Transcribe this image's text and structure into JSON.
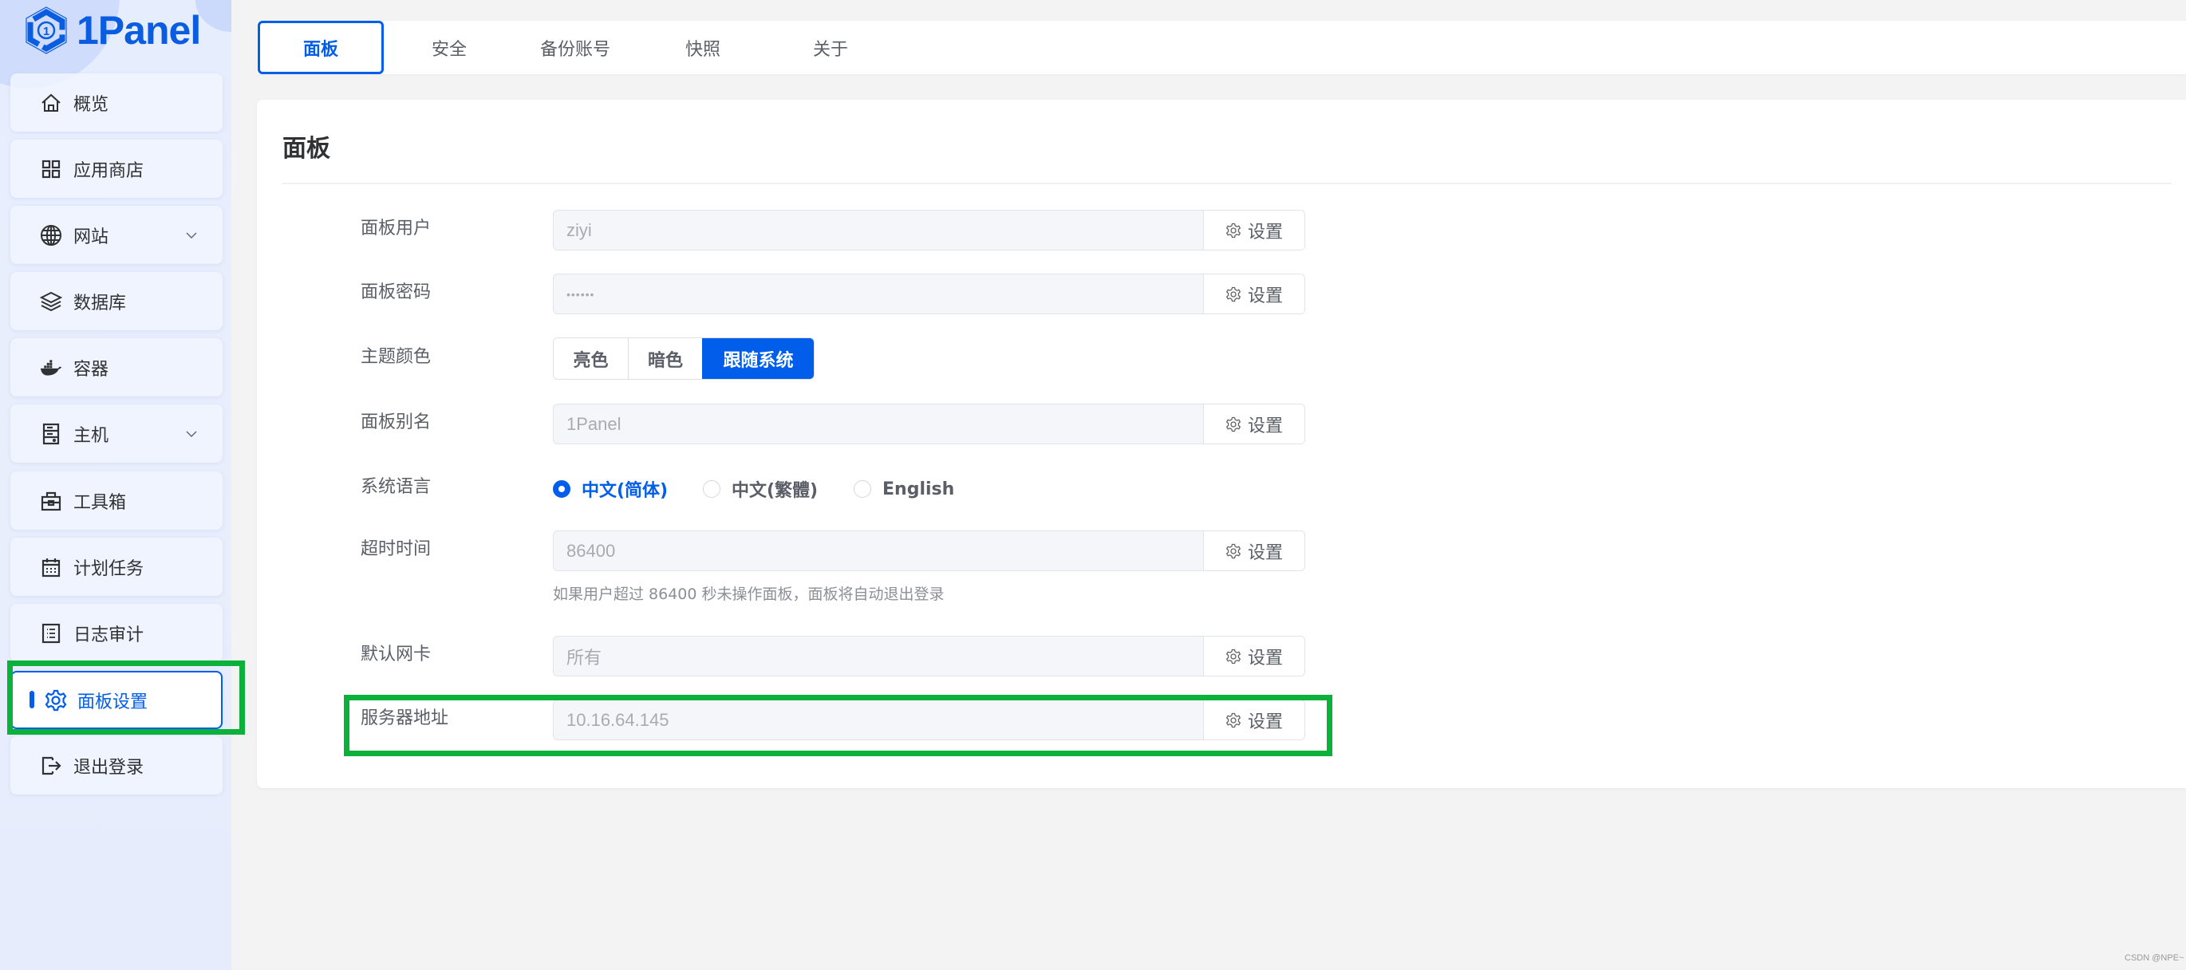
{
  "app": {
    "name": "1Panel"
  },
  "sidebar": {
    "items": [
      {
        "label": "概览",
        "icon": "home-icon",
        "has_chevron": false
      },
      {
        "label": "应用商店",
        "icon": "apps-grid-icon",
        "has_chevron": false
      },
      {
        "label": "网站",
        "icon": "globe-icon",
        "has_chevron": true
      },
      {
        "label": "数据库",
        "icon": "layers-icon",
        "has_chevron": false
      },
      {
        "label": "容器",
        "icon": "docker-icon",
        "has_chevron": false
      },
      {
        "label": "主机",
        "icon": "server-icon",
        "has_chevron": true
      },
      {
        "label": "工具箱",
        "icon": "toolbox-icon",
        "has_chevron": false
      },
      {
        "label": "计划任务",
        "icon": "calendar-icon",
        "has_chevron": false
      },
      {
        "label": "日志审计",
        "icon": "log-list-icon",
        "has_chevron": false
      },
      {
        "label": "面板设置",
        "icon": "gear-icon",
        "has_chevron": false,
        "active": true
      },
      {
        "label": "退出登录",
        "icon": "logout-icon",
        "has_chevron": false
      }
    ]
  },
  "tabs": [
    {
      "label": "面板",
      "active": true
    },
    {
      "label": "安全"
    },
    {
      "label": "备份账号"
    },
    {
      "label": "快照"
    },
    {
      "label": "关于"
    }
  ],
  "card": {
    "title": "面板",
    "set_button_label": "设置",
    "fields": {
      "user": {
        "label": "面板用户",
        "value": "ziyi"
      },
      "password": {
        "label": "面板密码",
        "value": "••••••"
      },
      "theme": {
        "label": "主题颜色",
        "options": [
          "亮色",
          "暗色",
          "跟随系统"
        ],
        "selected": "跟随系统"
      },
      "alias": {
        "label": "面板别名",
        "value": "1Panel"
      },
      "language": {
        "label": "系统语言",
        "options": [
          "中文(简体)",
          "中文(繁體)",
          "English"
        ],
        "selected": "中文(简体)"
      },
      "timeout": {
        "label": "超时时间",
        "value": "86400",
        "hint": "如果用户超过 86400 秒未操作面板，面板将自动退出登录"
      },
      "nic": {
        "label": "默认网卡",
        "value": "所有"
      },
      "server_address": {
        "label": "服务器地址",
        "value": "10.16.64.145"
      }
    }
  },
  "annotations": {
    "highlight_color": "#0cb13c"
  },
  "colors": {
    "accent": "#005eeb",
    "logo": "#0a5ce0"
  },
  "watermark": "CSDN @NPE~"
}
